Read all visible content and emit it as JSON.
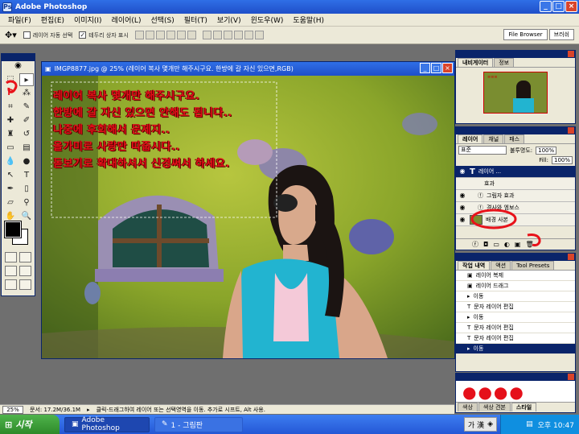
{
  "app": {
    "title": "Adobe Photoshop"
  },
  "menu": [
    "파일(F)",
    "편집(E)",
    "이미지(I)",
    "레이어(L)",
    "선택(S)",
    "필터(T)",
    "보기(V)",
    "윈도우(W)",
    "도움말(H)"
  ],
  "options": {
    "auto_select_layer": "레이어 자동 선택",
    "show_bounding_box": "테두리 상자 표시"
  },
  "palette_well": {
    "file_browser": "File Browser",
    "brushes": "브러쉬"
  },
  "document": {
    "title": "IMGP8877.jpg @ 25% (레이어 복사 몇개만 해주시구요. 한방에 갈 자신 있으면,RGB)",
    "overlay_lines": [
      "레이어 복사 몇개만 해주시구요.",
      "한방에 갈 자신 있으면 안해도 됩니다..",
      "나중에 후회해서 문제지..",
      "올가미로 사랑만 따줍시다..",
      "돋보기로 확대하셔서 신경써서 하세요."
    ]
  },
  "navigator": {
    "tabs": [
      "내비게이터",
      "정보"
    ]
  },
  "layers": {
    "tabs": [
      "레이어",
      "채널",
      "패스"
    ],
    "mode": "표준",
    "opacity_label": "불투명도:",
    "opacity": "100%",
    "fill_label": "Fill:",
    "fill": "100%",
    "items": [
      {
        "name": "레이어 ...",
        "kind": "text",
        "selected": false
      },
      {
        "name": "효과",
        "kind": "label",
        "selected": false
      },
      {
        "name": "그림자 효과",
        "kind": "effect",
        "selected": false
      },
      {
        "name": "경사와 엠보스",
        "kind": "effect",
        "selected": false
      },
      {
        "name": "배경 사본",
        "kind": "image",
        "selected": false
      }
    ]
  },
  "history": {
    "tabs": [
      "작업 내역",
      "액션",
      "Tool Presets"
    ],
    "items": [
      {
        "label": "레이어 복제",
        "selected": false
      },
      {
        "label": "레이어 드래그",
        "selected": false
      },
      {
        "label": "이동",
        "selected": false
      },
      {
        "label": "문자 레이어 편집",
        "selected": false
      },
      {
        "label": "이동",
        "selected": false
      },
      {
        "label": "문자 레이어 편집",
        "selected": false
      },
      {
        "label": "문자 레이어 편집",
        "selected": false
      },
      {
        "label": "이동",
        "selected": true
      }
    ]
  },
  "bottom_palette_tabs": [
    "색상",
    "색상 견본",
    "스타일"
  ],
  "status": {
    "zoom": "25%",
    "doc_size": "문서: 17.2M/36.1M",
    "hint": "클릭-드래그하여 레이어 또는 선택영역을 이동. 추가로 시프트, Alt 사용."
  },
  "taskbar": {
    "start": "시작",
    "tasks": [
      "Adobe Photoshop",
      "1 - 그림판"
    ],
    "ime": "가 漢",
    "clock": "오후 10:47"
  },
  "colors": {
    "overlay_text": "#e5101a",
    "annotation": "#e8121a"
  }
}
